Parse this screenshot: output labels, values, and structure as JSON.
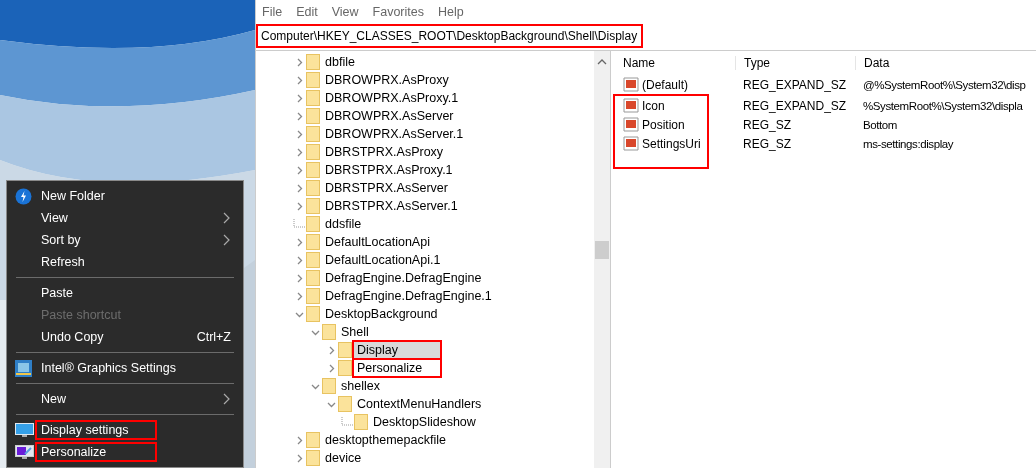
{
  "context_menu": {
    "groups": [
      [
        {
          "label": "New Folder",
          "icon": true,
          "submenu": false,
          "disabled": false,
          "annotated": false
        },
        {
          "label": "View",
          "icon": false,
          "submenu": true,
          "disabled": false,
          "annotated": false
        },
        {
          "label": "Sort by",
          "icon": false,
          "submenu": true,
          "disabled": false,
          "annotated": false
        },
        {
          "label": "Refresh",
          "icon": false,
          "submenu": false,
          "disabled": false,
          "annotated": false
        }
      ],
      [
        {
          "label": "Paste",
          "icon": false,
          "submenu": false,
          "disabled": false,
          "annotated": false
        },
        {
          "label": "Paste shortcut",
          "icon": false,
          "submenu": false,
          "disabled": true,
          "annotated": false
        },
        {
          "label": "Undo Copy",
          "shortcut": "Ctrl+Z",
          "icon": false,
          "submenu": false,
          "disabled": false,
          "annotated": false
        }
      ],
      [
        {
          "label": "Intel® Graphics Settings",
          "icon": true,
          "submenu": false,
          "disabled": false,
          "annotated": false
        }
      ],
      [
        {
          "label": "New",
          "icon": false,
          "submenu": true,
          "disabled": false,
          "annotated": false
        }
      ],
      [
        {
          "label": "Display settings",
          "icon": true,
          "submenu": false,
          "disabled": false,
          "annotated": true
        },
        {
          "label": "Personalize",
          "icon": true,
          "submenu": false,
          "disabled": false,
          "annotated": true
        }
      ]
    ]
  },
  "menu_bar": [
    "File",
    "Edit",
    "View",
    "Favorites",
    "Help"
  ],
  "address_bar": {
    "value": "Computer\\HKEY_CLASSES_ROOT\\DesktopBackground\\Shell\\Display",
    "annotated": true
  },
  "tree": [
    {
      "label": "dbfile",
      "leaf": false,
      "expanded": false,
      "selected": false,
      "annotated": false
    },
    {
      "label": "DBROWPRX.AsProxy",
      "leaf": false,
      "expanded": false,
      "selected": false,
      "annotated": false
    },
    {
      "label": "DBROWPRX.AsProxy.1",
      "leaf": false,
      "expanded": false,
      "selected": false,
      "annotated": false
    },
    {
      "label": "DBROWPRX.AsServer",
      "leaf": false,
      "expanded": false,
      "selected": false,
      "annotated": false
    },
    {
      "label": "DBROWPRX.AsServer.1",
      "leaf": false,
      "expanded": false,
      "selected": false,
      "annotated": false
    },
    {
      "label": "DBRSTPRX.AsProxy",
      "leaf": false,
      "expanded": false,
      "selected": false,
      "annotated": false
    },
    {
      "label": "DBRSTPRX.AsProxy.1",
      "leaf": false,
      "expanded": false,
      "selected": false,
      "annotated": false
    },
    {
      "label": "DBRSTPRX.AsServer",
      "leaf": false,
      "expanded": false,
      "selected": false,
      "annotated": false
    },
    {
      "label": "DBRSTPRX.AsServer.1",
      "leaf": false,
      "expanded": false,
      "selected": false,
      "annotated": false
    },
    {
      "label": "ddsfile",
      "leaf": true,
      "expanded": false,
      "selected": false,
      "annotated": false
    },
    {
      "label": "DefaultLocationApi",
      "leaf": false,
      "expanded": false,
      "selected": false,
      "annotated": false
    },
    {
      "label": "DefaultLocationApi.1",
      "leaf": false,
      "expanded": false,
      "selected": false,
      "annotated": false
    },
    {
      "label": "DefragEngine.DefragEngine",
      "leaf": false,
      "expanded": false,
      "selected": false,
      "annotated": false
    },
    {
      "label": "DefragEngine.DefragEngine.1",
      "leaf": false,
      "expanded": false,
      "selected": false,
      "annotated": false
    },
    {
      "label": "DesktopBackground",
      "leaf": false,
      "expanded": true,
      "selected": false,
      "annotated": false,
      "children": [
        {
          "label": "Shell",
          "leaf": false,
          "expanded": true,
          "selected": false,
          "annotated": false,
          "children": [
            {
              "label": "Display",
              "leaf": false,
              "expanded": false,
              "selected": true,
              "annotated": true
            },
            {
              "label": "Personalize",
              "leaf": false,
              "expanded": false,
              "selected": false,
              "annotated": true
            }
          ]
        },
        {
          "label": "shellex",
          "leaf": false,
          "expanded": true,
          "selected": false,
          "annotated": false,
          "children": [
            {
              "label": "ContextMenuHandlers",
              "leaf": false,
              "expanded": true,
              "selected": false,
              "annotated": false,
              "children": [
                {
                  "label": "DesktopSlideshow",
                  "leaf": true,
                  "expanded": false,
                  "selected": false,
                  "annotated": false
                }
              ]
            }
          ]
        }
      ]
    },
    {
      "label": "desktopthemepackfile",
      "leaf": false,
      "expanded": false,
      "selected": false,
      "annotated": false
    },
    {
      "label": "device",
      "leaf": false,
      "expanded": false,
      "selected": false,
      "annotated": false
    }
  ],
  "values": {
    "columns": [
      "Name",
      "Type",
      "Data"
    ],
    "rows": [
      {
        "name": "(Default)",
        "type": "REG_EXPAND_SZ",
        "data": "@%SystemRoot%\\System32\\disp",
        "annotated": false
      },
      {
        "name": "Icon",
        "type": "REG_EXPAND_SZ",
        "data": "%SystemRoot%\\System32\\displa",
        "annotated": true
      },
      {
        "name": "Position",
        "type": "REG_SZ",
        "data": "Bottom",
        "annotated": true
      },
      {
        "name": "SettingsUri",
        "type": "REG_SZ",
        "data": "ms-settings:display",
        "annotated": true
      }
    ]
  }
}
